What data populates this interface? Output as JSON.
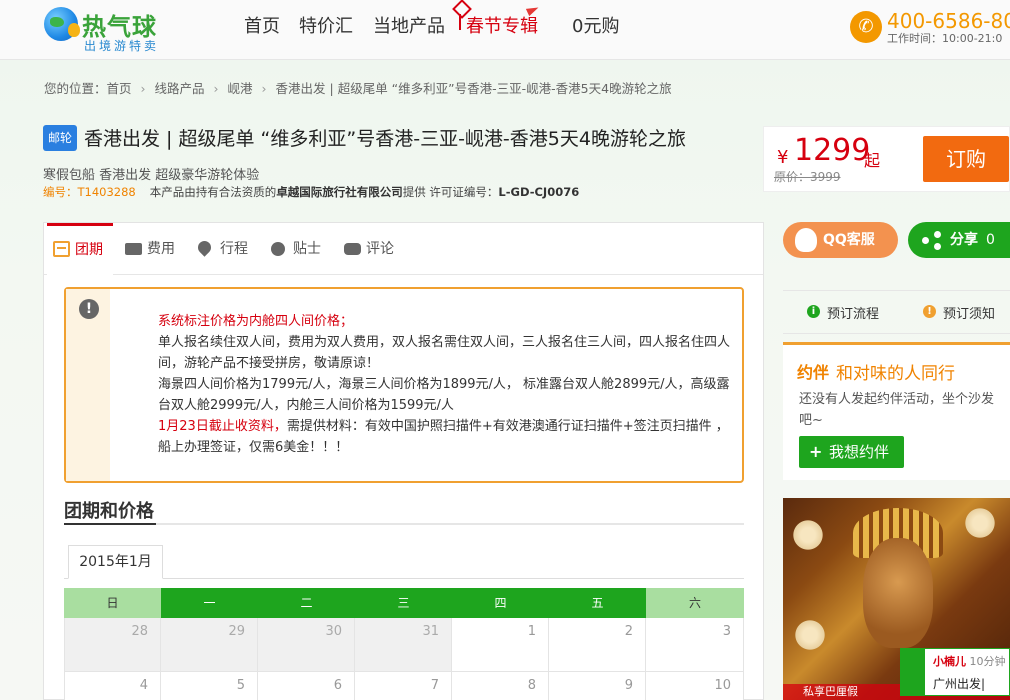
{
  "header": {
    "logo_title": "热气球",
    "logo_sub": "出境游特卖",
    "nav": [
      "首页",
      "特价汇",
      "当地产品",
      "春节专辑",
      "0元购"
    ],
    "hotline": "400-6586-80",
    "hours": "工作时间：10:00-21:0"
  },
  "breadcrumb": [
    "您的位置：首页",
    "线路产品",
    "岘港",
    "香港出发 | 超级尾单 “维多利亚”号香港-三亚-岘港-香港5天4晚游轮之旅"
  ],
  "product": {
    "tag": "邮轮",
    "title": "香港出发 | 超级尾单 “维多利亚”号香港-三亚-岘港-香港5天4晚游轮之旅",
    "subtitle": "寒假包船 香港出发 超级豪华游轮体验",
    "code": "编号：T1403288",
    "provider_prefix": "本产品由持有合法资质的",
    "provider": "卓越国际旅行社有限公司",
    "provider_suffix": "提供 许可证编号：",
    "license": "L-GD-CJ0076"
  },
  "price": {
    "symbol": "¥",
    "amount": "1299",
    "suffix": "起",
    "original": "原价：3999",
    "book_label": "订购"
  },
  "tabs": [
    "团期",
    "费用",
    "行程",
    "贴士",
    "评论"
  ],
  "notice": {
    "line1": "系统标注价格为内舱四人间价格；",
    "line2": "单人报名续住双人间，费用为双人费用，双人报名需住双人间，三人报名住三人间，四人报名住四人间，游轮产品不接受拼房，敬请原谅！",
    "line3": "海景四人间价格为1799元/人，海景三人间价格为1899元/人， 标准露台双人舱2899元/人，高级露台双人舱2999元/人，内舱三人间价格为1599元/人",
    "line4_red": "1月23日截止收资料，",
    "line4": "需提供材料：有效中国护照扫描件+有效港澳通行证扫描件+签注页扫描件 ，船上办理签证，仅需6美金！！！"
  },
  "section_title": "团期和价格",
  "month": "2015年1月",
  "calendar": {
    "weekdays": [
      "日",
      "一",
      "二",
      "三",
      "四",
      "五",
      "六"
    ],
    "row1": [
      "28",
      "29",
      "30",
      "31",
      "1",
      "2",
      "3"
    ],
    "row2": [
      "4",
      "5",
      "6",
      "7",
      "8",
      "9",
      "10"
    ]
  },
  "side": {
    "qq_label": "QQ客服",
    "share_label": "分享",
    "share_count": "0",
    "flow_label": "预订流程",
    "notes_label": "预订须知",
    "partner_logo": "约伴",
    "partner_title": "和对味的人同行",
    "partner_desc": "还没有人发起约伴活动，坐个沙发吧~",
    "partner_btn": "我想约伴",
    "chat_name": "小楠儿",
    "chat_time": "10分钟",
    "chat_line": "广州出发|",
    "ad_text": "私享巴厘假"
  },
  "colors": {
    "brand_green": "#1ea51e",
    "accent_orange": "#f26a10",
    "price_red": "#d6000f"
  }
}
